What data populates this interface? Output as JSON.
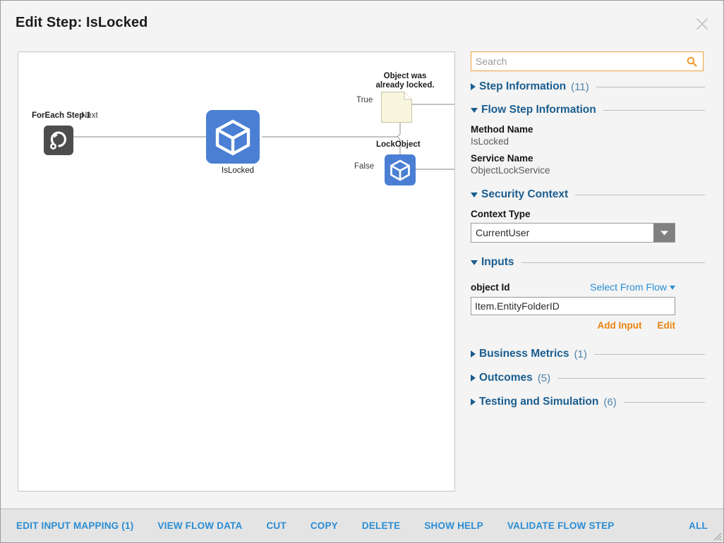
{
  "dialog": {
    "title": "Edit Step: IsLocked",
    "close_icon": "close-icon"
  },
  "colors": {
    "accent_blue": "#2a8dd4",
    "section_blue": "#1a5d8f",
    "orange": "#e8820c",
    "search_border": "#f0a23c",
    "node_blue": "#4a7fd4",
    "note_yellow": "#f8f6dc",
    "foreach_gray": "#4d4d4d"
  },
  "flow": {
    "nodes": [
      {
        "id": "foreach",
        "label": "ForEach Step 1",
        "icon": "loop-icon"
      },
      {
        "id": "islocked",
        "label": "IsLocked",
        "icon": "cube-icon"
      },
      {
        "id": "note",
        "label": "Object was\nalready locked.",
        "label_line1": "Object was",
        "label_line2": "already locked.",
        "icon": "note-icon"
      },
      {
        "id": "lockobject",
        "label": "LockObject",
        "icon": "cube-icon"
      }
    ],
    "edges": [
      {
        "from": "foreach",
        "to": "islocked",
        "label": "Next"
      },
      {
        "from": "islocked",
        "to": "note",
        "label": "True"
      },
      {
        "from": "islocked",
        "to": "lockobject",
        "label": "False"
      }
    ]
  },
  "search": {
    "value": "",
    "placeholder": "Search",
    "icon": "search-icon"
  },
  "panel": {
    "sections": [
      {
        "id": "step-information",
        "title": "Step Information",
        "count": "(11)",
        "expanded": false
      },
      {
        "id": "flow-step-information",
        "title": "Flow Step Information",
        "count": "",
        "expanded": true
      },
      {
        "id": "security-context",
        "title": "Security Context",
        "count": "",
        "expanded": true
      },
      {
        "id": "inputs",
        "title": "Inputs",
        "count": "",
        "expanded": true
      },
      {
        "id": "business-metrics",
        "title": "Business Metrics",
        "count": "(1)",
        "expanded": false
      },
      {
        "id": "outcomes",
        "title": "Outcomes",
        "count": "(5)",
        "expanded": false
      },
      {
        "id": "testing-and-simulation",
        "title": "Testing and Simulation",
        "count": "(6)",
        "expanded": false
      }
    ],
    "flow_step_information": {
      "method_name_label": "Method Name",
      "method_name_value": "IsLocked",
      "service_name_label": "Service Name",
      "service_name_value": "ObjectLockService"
    },
    "security_context": {
      "context_type_label": "Context Type",
      "context_type_value": "CurrentUser"
    },
    "inputs": {
      "input_name": "object Id",
      "select_from_flow": "Select From Flow",
      "input_value": "Item.EntityFolderID",
      "add_input": "Add Input",
      "edit": "Edit"
    }
  },
  "toolbar": {
    "items": [
      "EDIT INPUT MAPPING (1)",
      "VIEW FLOW DATA",
      "CUT",
      "COPY",
      "DELETE",
      "SHOW HELP",
      "VALIDATE FLOW STEP"
    ],
    "all": "ALL"
  }
}
